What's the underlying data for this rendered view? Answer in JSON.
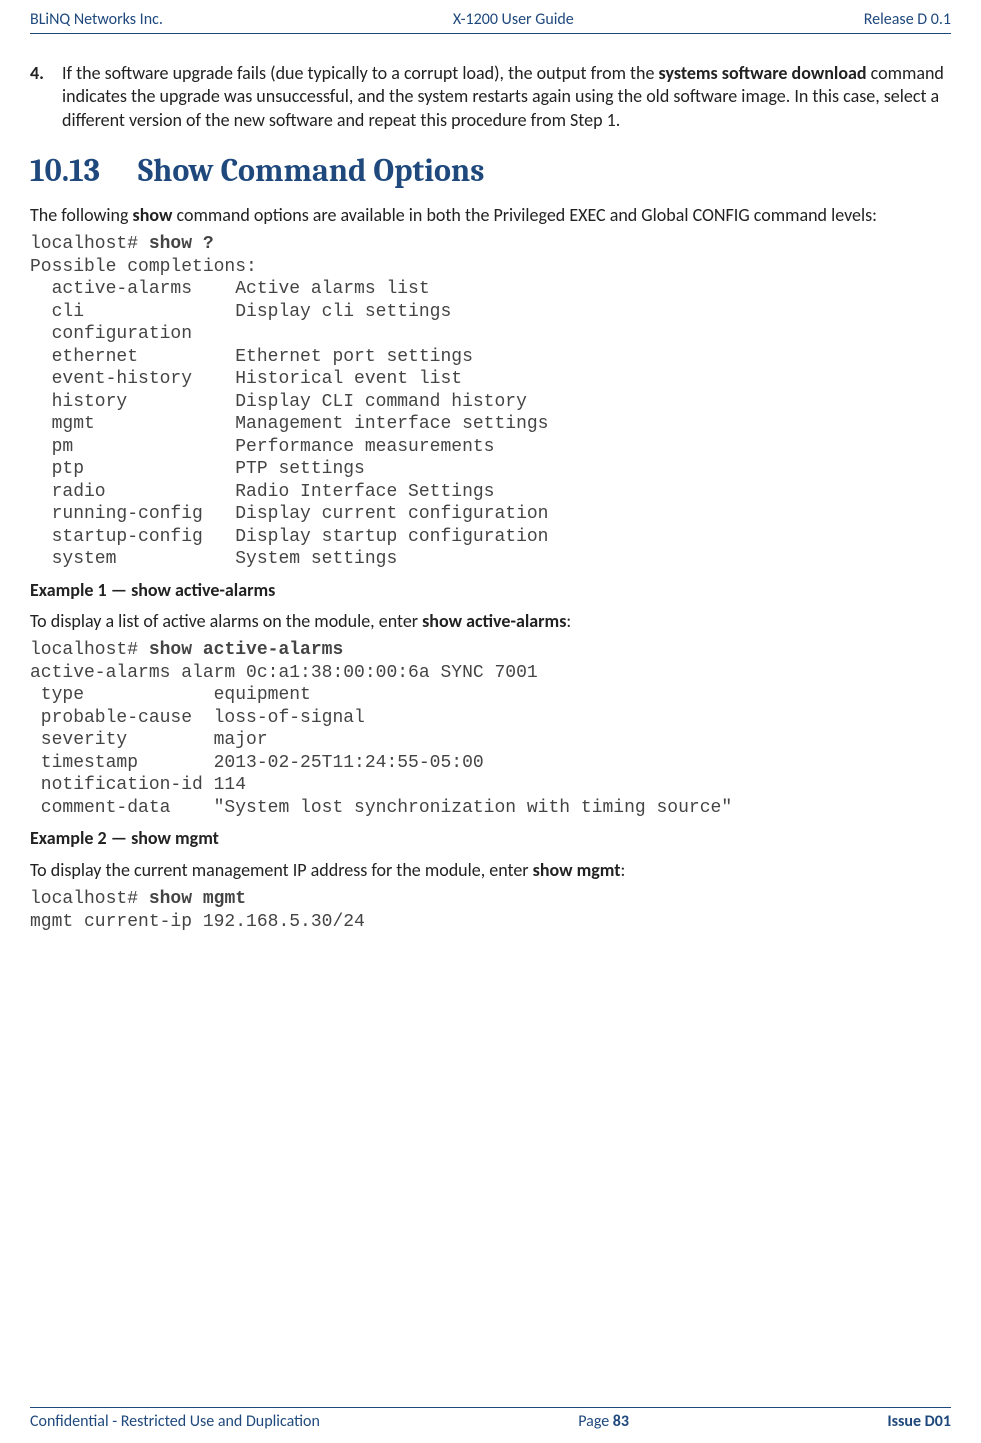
{
  "header": {
    "left": "BLiNQ Networks Inc.",
    "center": "X-1200 User Guide",
    "right": "Release D 0.1"
  },
  "step4": {
    "num": "4.",
    "t1": "If the software upgrade fails (due typically to a corrupt load), the output from the ",
    "b1": "systems software download",
    "t2": " command indicates the upgrade was unsuccessful, and the system restarts again using the old software image. In this case, select a different version of the new software and repeat this procedure from Step 1."
  },
  "heading": {
    "num": "10.13",
    "title": "Show Command Options"
  },
  "intro": {
    "t1": "The following ",
    "b1": "show",
    "t2": " command options are available in both the Privileged EXEC and Global CONFIG command levels:"
  },
  "code1": {
    "prompt": "localhost# ",
    "cmd": "show ?",
    "body": "Possible completions:\n  active-alarms    Active alarms list\n  cli              Display cli settings\n  configuration\n  ethernet         Ethernet port settings\n  event-history    Historical event list\n  history          Display CLI command history\n  mgmt             Management interface settings\n  pm               Performance measurements\n  ptp              PTP settings\n  radio            Radio Interface Settings\n  running-config   Display current configuration\n  startup-config   Display startup configuration\n  system           System settings"
  },
  "ex1": {
    "header": "Example 1 — show active-alarms",
    "p_t1": "To display a list of active alarms on the module, enter ",
    "p_b1": "show active-alarms",
    "p_t2": ":",
    "prompt": "localhost# ",
    "cmd": "show active-alarms",
    "body": "active-alarms alarm 0c:a1:38:00:00:6a SYNC 7001\n type            equipment\n probable-cause  loss-of-signal\n severity        major\n timestamp       2013-02-25T11:24:55-05:00\n notification-id 114\n comment-data    \"System lost synchronization with timing source\""
  },
  "ex2": {
    "header": "Example 2 — show mgmt",
    "p_t1": "To display the current management IP address for the module, enter ",
    "p_b1": "show mgmt",
    "p_t2": ":",
    "prompt": "localhost# ",
    "cmd": "show mgmt",
    "body": "mgmt current-ip 192.168.5.30/24"
  },
  "footer": {
    "left": "Confidential - Restricted Use and Duplication",
    "page_label": "Page ",
    "page_num": "83",
    "right": "Issue D01"
  }
}
